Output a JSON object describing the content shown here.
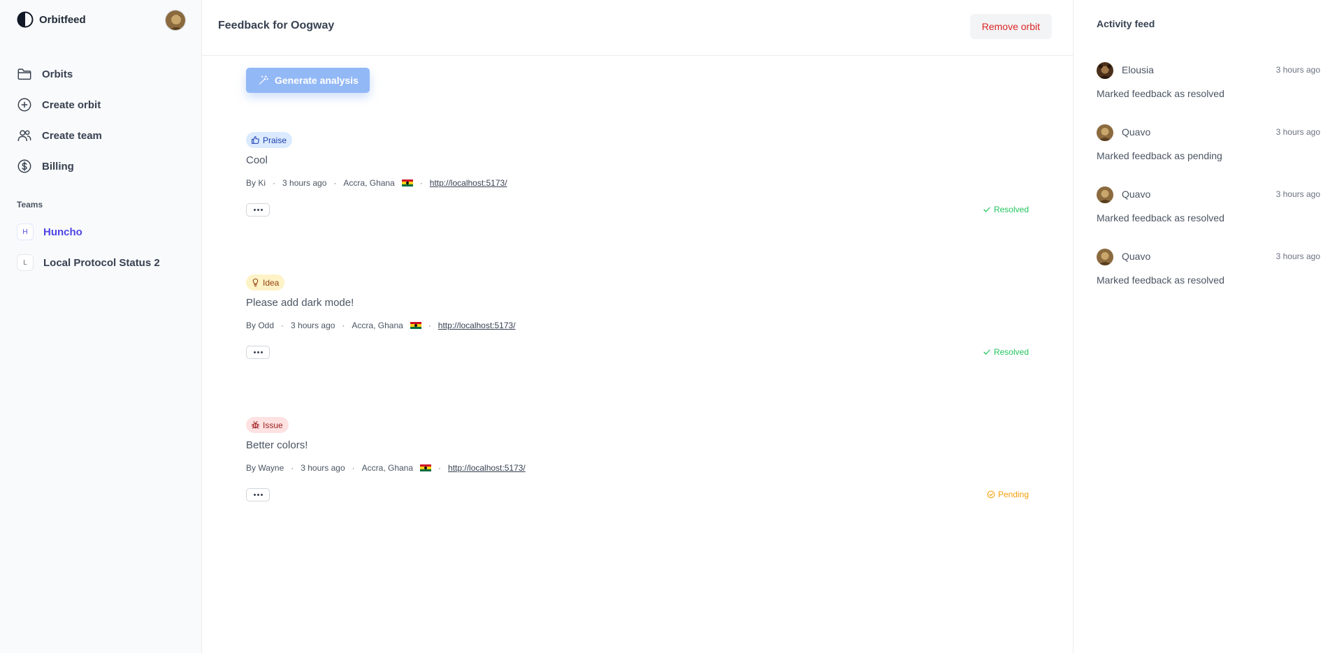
{
  "brand": {
    "name": "Orbitfeed"
  },
  "nav": {
    "items": [
      {
        "label": "Orbits",
        "icon": "folder-icon"
      },
      {
        "label": "Create orbit",
        "icon": "plus-circle-icon"
      },
      {
        "label": "Create team",
        "icon": "users-icon"
      },
      {
        "label": "Billing",
        "icon": "dollar-circle-icon"
      }
    ]
  },
  "teams": {
    "heading": "Teams",
    "items": [
      {
        "initial": "H",
        "label": "Huncho",
        "active": true
      },
      {
        "initial": "L",
        "label": "Local Protocol Status 2",
        "active": false
      }
    ]
  },
  "header": {
    "title": "Feedback for Oogway",
    "remove_label": "Remove orbit"
  },
  "generate": {
    "label": "Generate analysis"
  },
  "feedback": [
    {
      "tag": "Praise",
      "text": "Cool",
      "author": "By Ki",
      "time": "3 hours ago",
      "location": "Accra, Ghana",
      "url": "http://localhost:5173/",
      "status": "Resolved"
    },
    {
      "tag": "Idea",
      "text": "Please add dark mode!",
      "author": "By Odd",
      "time": "3 hours ago",
      "location": "Accra, Ghana",
      "url": "http://localhost:5173/",
      "status": "Resolved"
    },
    {
      "tag": "Issue",
      "text": "Better colors!",
      "author": "By Wayne",
      "time": "3 hours ago",
      "location": "Accra, Ghana",
      "url": "http://localhost:5173/",
      "status": "Pending"
    }
  ],
  "activity": {
    "title": "Activity feed",
    "items": [
      {
        "user": "Elousia",
        "time": "3 hours ago",
        "text": "Marked feedback as resolved"
      },
      {
        "user": "Quavo",
        "time": "3 hours ago",
        "text": "Marked feedback as pending"
      },
      {
        "user": "Quavo",
        "time": "3 hours ago",
        "text": "Marked feedback as resolved"
      },
      {
        "user": "Quavo",
        "time": "3 hours ago",
        "text": "Marked feedback as resolved"
      }
    ]
  },
  "colors": {
    "accent": "#4f46e5",
    "danger": "#dc2626",
    "resolved": "#22c55e",
    "pending": "#f59e0b",
    "generate_button": "#93b8f6"
  }
}
